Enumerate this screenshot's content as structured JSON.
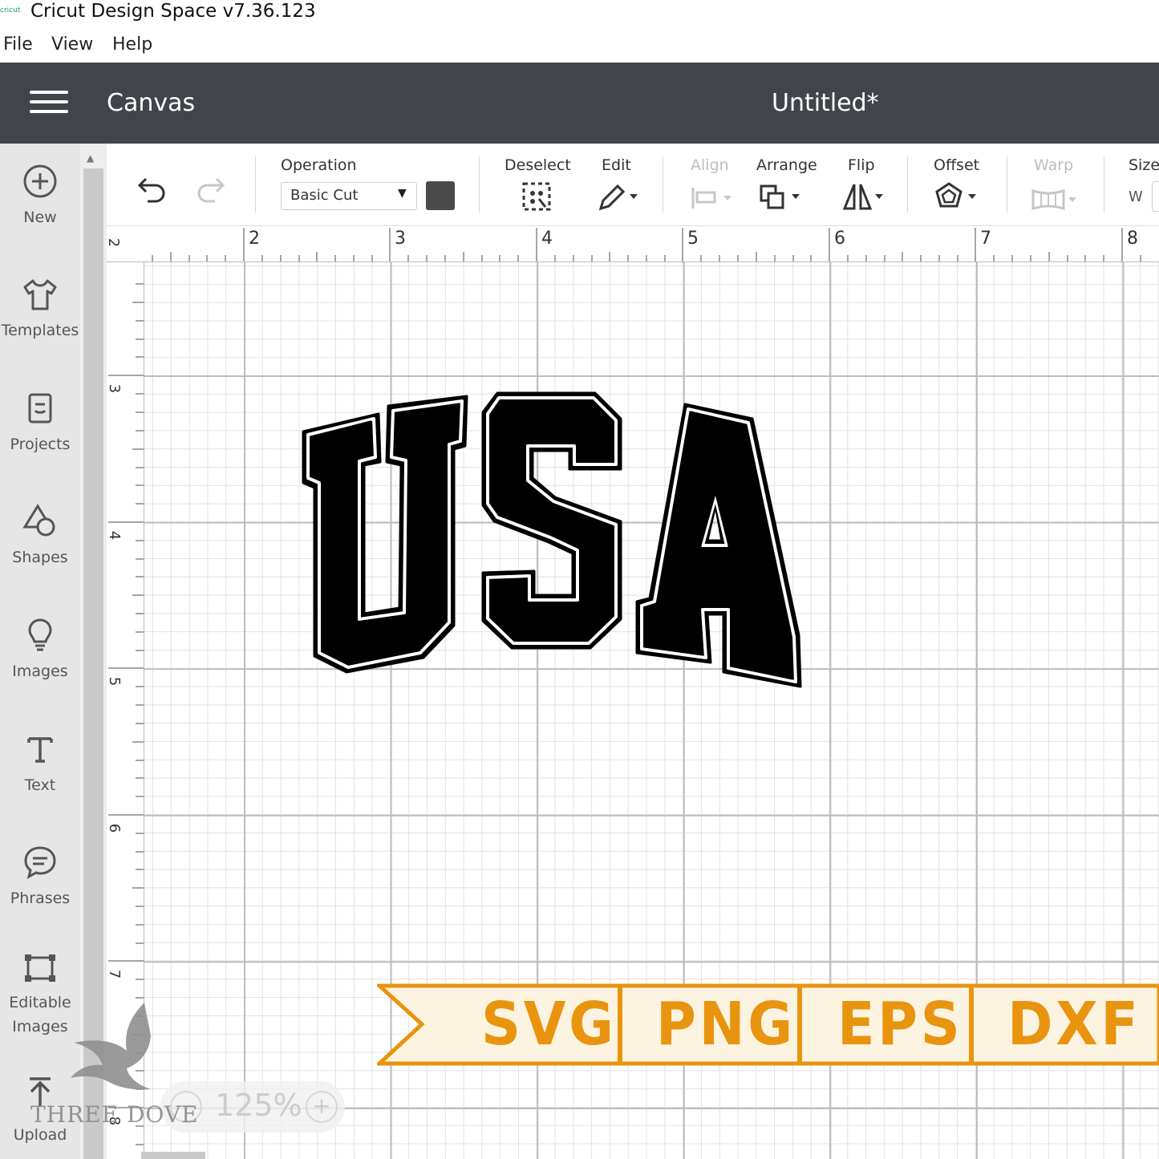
{
  "window": {
    "app_title": "Cricut Design Space  v7.36.123",
    "logo_text": "cricut"
  },
  "menu": [
    "File",
    "View",
    "Help"
  ],
  "header": {
    "title": "Canvas",
    "document": "Untitled*"
  },
  "sidebar": {
    "items": [
      {
        "label": "New",
        "icon": "plus-circle-icon"
      },
      {
        "label": "Templates",
        "icon": "tshirt-icon"
      },
      {
        "label": "Projects",
        "icon": "projects-icon"
      },
      {
        "label": "Shapes",
        "icon": "shapes-icon"
      },
      {
        "label": "Images",
        "icon": "lightbulb-icon"
      },
      {
        "label": "Text",
        "icon": "text-icon"
      },
      {
        "label": "Phrases",
        "icon": "speech-bubble-icon"
      },
      {
        "label": "Editable",
        "label2": "Images",
        "icon": "editable-images-icon"
      },
      {
        "label": "Upload",
        "icon": "upload-icon"
      }
    ]
  },
  "toolbar": {
    "operation_label": "Operation",
    "operation_value": "Basic Cut",
    "swatch_color": "#4a4a4a",
    "deselect": "Deselect",
    "edit": "Edit",
    "align": "Align",
    "arrange": "Arrange",
    "flip": "Flip",
    "offset": "Offset",
    "warp": "Warp",
    "size": "Size",
    "size_w": "W"
  },
  "ruler": {
    "top": [
      "2",
      "2",
      "3",
      "4",
      "5",
      "6",
      "7",
      "8"
    ],
    "left": [
      "3",
      "4",
      "5",
      "6",
      "7",
      "8"
    ]
  },
  "canvas": {
    "design_text": "USA",
    "banner_formats": [
      "SVG",
      "PNG",
      "EPS",
      "DXF"
    ],
    "banner_color": "#e8940f"
  },
  "zoom": {
    "value": "125%"
  },
  "watermark": "THREE DOVE"
}
